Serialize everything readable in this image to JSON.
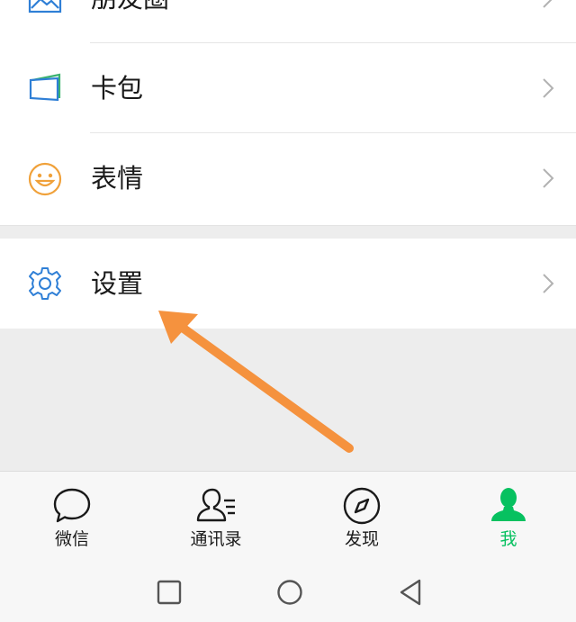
{
  "menu": {
    "moments_label": "朋友圈",
    "cards_label": "卡包",
    "stickers_label": "表情",
    "settings_label": "设置"
  },
  "tabbar": {
    "chats_label": "微信",
    "contacts_label": "通讯录",
    "discover_label": "发现",
    "me_label": "我"
  },
  "colors": {
    "accent": "#07c160",
    "annotation_arrow": "#f5923e",
    "icon_blue": "#2f7fd6",
    "icon_orange": "#f0a13a",
    "background": "#ededed"
  },
  "icons": {
    "moments": "image-icon",
    "cards": "wallet-icon",
    "stickers": "smiley-icon",
    "settings": "gear-icon",
    "chevron": "chevron-right-icon",
    "chats": "chat-bubble-icon",
    "contacts": "contacts-icon",
    "discover": "compass-icon",
    "me": "person-icon"
  }
}
